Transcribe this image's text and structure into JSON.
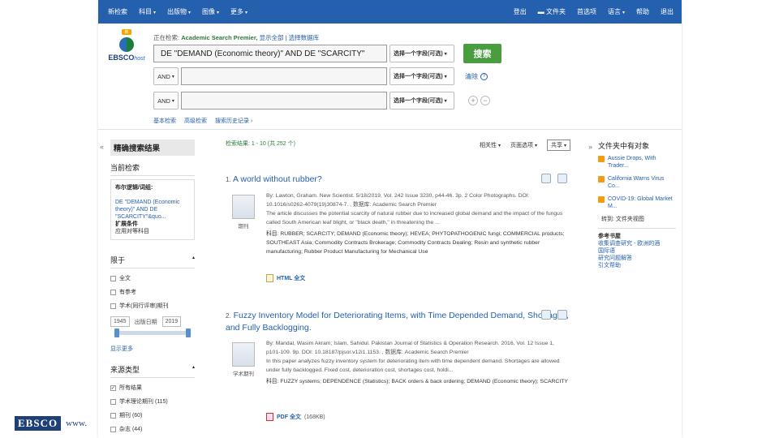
{
  "topnav": {
    "left": [
      "新检索",
      "科目",
      "出版物",
      "图像",
      "更多"
    ],
    "right": [
      "登出",
      "文件夹",
      "首选项",
      "语言",
      "帮助",
      "退出"
    ]
  },
  "logo": {
    "badge": "新",
    "brand": "EBSCO",
    "suffix": "host"
  },
  "search": {
    "database_prefix": "正在检索:",
    "database": "Academic Search Premier,",
    "show_all": "显示全部",
    "choose_db": "选择数据库",
    "query": "DE \"DEMAND (Economic theory)\" AND DE \"SCARCITY\"",
    "field_placeholder": "选择一个字段(可选)",
    "bool": "AND",
    "search_button": "搜索",
    "clear": "清除",
    "basic": "基本检索",
    "advanced": "高级检索",
    "history": "搜索历史记录"
  },
  "left_panel": {
    "title": "精确搜索结果",
    "current": "当前检索",
    "boolean_label": "布尔逻辑/词组:",
    "boolean_value": "DE \"DEMAND (Economic theory)\" AND DE \"SCARCITY\"&quo...",
    "expanders": "扩展条件",
    "expander_item": "应用对等科目",
    "limit": "限于",
    "limit_items": [
      "全文",
      "有参考",
      "学术(同行评审)期刊"
    ],
    "date_from": "1945",
    "date_label": "出版日期",
    "date_to": "2019",
    "show_more": "显示更多",
    "source_type": "来源类型",
    "sources": [
      "所有结果",
      "学术理论期刊 (115)",
      "期刊 (60)",
      "杂志 (44)"
    ]
  },
  "results": {
    "count": "检索结果: 1 - 10 (共 252 个)",
    "relevance": "相关性",
    "page_options": "页面选项",
    "share": "共享",
    "items": [
      {
        "num": "1.",
        "title": "A world without rubber?",
        "meta": "By: Lawton, Graham. New Scientist. 5/18/2019, Vol. 242 Issue 3230, p44-46. 3p. 2 Color Photographs. DOI: 10.1016/s0262-4079(19)30874-7. , 数据库: Academic Search Premier",
        "abstract": "The article discusses the potential scarcity of natural rubber due to increased global demand and the impact of the fungus called South American leaf blight, or \"black death,\" in threatening the ...",
        "subjects": "科目: RUBBER; SCARCITY; DEMAND (Economic theory); HEVEA; PHYTOPATHOGENIC fungi; COMMERCIAL products; SOUTHEAST Asia; Commodity Contracts Brokerage; Commodity Contracts Dealing; Resin and synthetic rubber manufacturing; Rubber Product Manufacturing for Mechanical Use",
        "type": "期刊",
        "fulltext": "HTML 全文"
      },
      {
        "num": "2.",
        "title": "Fuzzy Inventory Model for Deteriorating Items, with Time Depended Demand, Shortages, and Fully Backlogging.",
        "meta": "By: Mandal, Wasim Akram; Islam, Sahidul. Pakistan Journal of Statistics & Operation Research. 2016, Vol. 12 Issue 1, p101-109. 9p. DOI: 10.18187/pjsor.v12i1.1153. , 数据库: Academic Search Premier",
        "abstract": "In this paper analyzes fuzzy inventory system for deteriorating item with time dependent demand. Shortages are allowed under fully backlogged. Fixed cost, deterioration cost, shortages cost, holdi...",
        "subjects": "科目: FUZZY systems; DEPENDENCE (Statistics); BACK orders & back ordering; DEMAND (Economic theory); SCARCITY",
        "type": "学术期刊",
        "fulltext": "PDF 全文",
        "size": "(168KB)"
      }
    ]
  },
  "right_panel": {
    "title": "文件夹中有对象",
    "items": [
      "Aussie Drops, With Trader...",
      "California Warns Virus Co...",
      "COVID-19: Global Market M..."
    ],
    "more": "转到: 文件夹视图",
    "refs_title": "参考书屋",
    "refs": [
      "收集调查研究 - 欧洲的酒",
      "国际语",
      "研究问题解答",
      "引文帮助"
    ]
  },
  "footer": {
    "logo": "EBSCO",
    "url": "www."
  }
}
